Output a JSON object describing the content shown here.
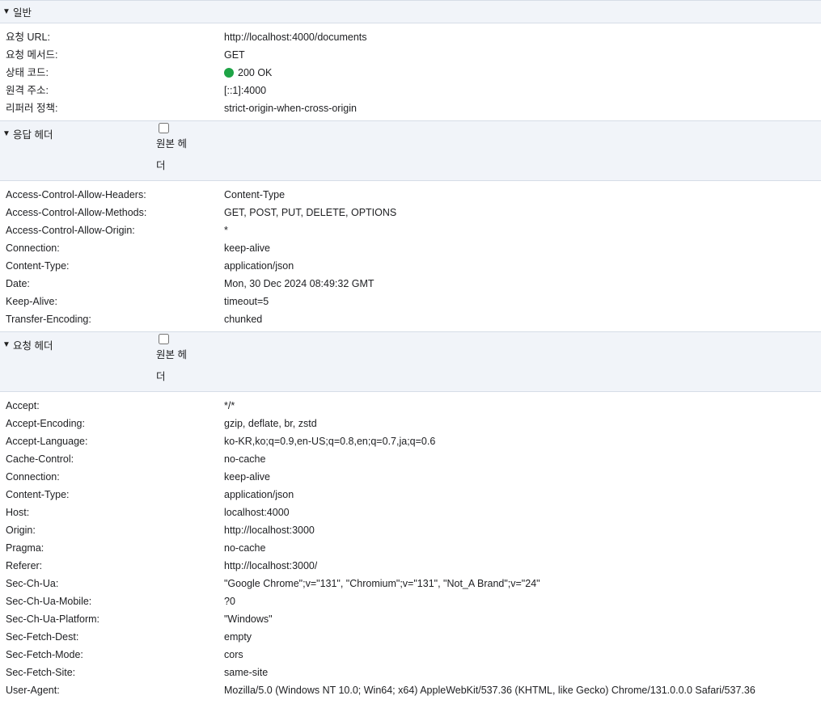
{
  "general": {
    "title": "일반",
    "rows": [
      {
        "key": "요청 URL:",
        "value": "http://localhost:4000/documents"
      },
      {
        "key": "요청 메서드:",
        "value": "GET"
      },
      {
        "key": "상태 코드:",
        "value": "200 OK"
      },
      {
        "key": "원격 주소:",
        "value": "[::1]:4000"
      },
      {
        "key": "리퍼러 정책:",
        "value": "strict-origin-when-cross-origin"
      }
    ],
    "status_color": "#1ea446"
  },
  "response_headers": {
    "title": "응답 헤더",
    "raw_label": "원본 헤더",
    "rows": [
      {
        "key": "Access-Control-Allow-Headers:",
        "value": "Content-Type"
      },
      {
        "key": "Access-Control-Allow-Methods:",
        "value": "GET, POST, PUT, DELETE, OPTIONS"
      },
      {
        "key": "Access-Control-Allow-Origin:",
        "value": "*"
      },
      {
        "key": "Connection:",
        "value": "keep-alive"
      },
      {
        "key": "Content-Type:",
        "value": "application/json"
      },
      {
        "key": "Date:",
        "value": "Mon, 30 Dec 2024 08:49:32 GMT"
      },
      {
        "key": "Keep-Alive:",
        "value": "timeout=5"
      },
      {
        "key": "Transfer-Encoding:",
        "value": "chunked"
      }
    ]
  },
  "request_headers": {
    "title": "요청 헤더",
    "raw_label": "원본 헤더",
    "rows": [
      {
        "key": "Accept:",
        "value": "*/*"
      },
      {
        "key": "Accept-Encoding:",
        "value": "gzip, deflate, br, zstd"
      },
      {
        "key": "Accept-Language:",
        "value": "ko-KR,ko;q=0.9,en-US;q=0.8,en;q=0.7,ja;q=0.6"
      },
      {
        "key": "Cache-Control:",
        "value": "no-cache"
      },
      {
        "key": "Connection:",
        "value": "keep-alive"
      },
      {
        "key": "Content-Type:",
        "value": "application/json"
      },
      {
        "key": "Host:",
        "value": "localhost:4000"
      },
      {
        "key": "Origin:",
        "value": "http://localhost:3000"
      },
      {
        "key": "Pragma:",
        "value": "no-cache"
      },
      {
        "key": "Referer:",
        "value": "http://localhost:3000/"
      },
      {
        "key": "Sec-Ch-Ua:",
        "value": "\"Google Chrome\";v=\"131\", \"Chromium\";v=\"131\", \"Not_A Brand\";v=\"24\""
      },
      {
        "key": "Sec-Ch-Ua-Mobile:",
        "value": "?0"
      },
      {
        "key": "Sec-Ch-Ua-Platform:",
        "value": "\"Windows\""
      },
      {
        "key": "Sec-Fetch-Dest:",
        "value": "empty"
      },
      {
        "key": "Sec-Fetch-Mode:",
        "value": "cors"
      },
      {
        "key": "Sec-Fetch-Site:",
        "value": "same-site"
      },
      {
        "key": "User-Agent:",
        "value": "Mozilla/5.0 (Windows NT 10.0; Win64; x64) AppleWebKit/537.36 (KHTML, like Gecko) Chrome/131.0.0.0 Safari/537.36"
      }
    ]
  }
}
